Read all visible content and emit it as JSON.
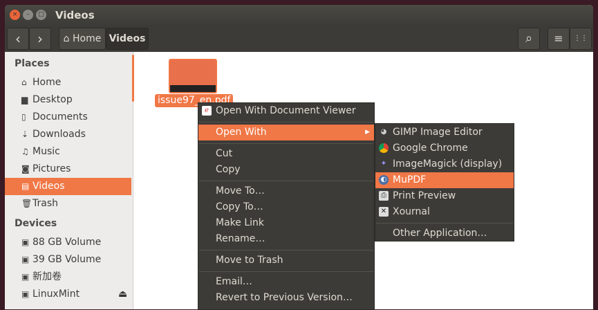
{
  "window": {
    "title": "Videos"
  },
  "toolbar": {
    "back": "‹",
    "forward": "›",
    "crumbs": [
      "Home",
      "Videos"
    ],
    "search": "⌕",
    "list": "≡",
    "grid": "⋮⋮"
  },
  "sidebar": {
    "places_heading": "Places",
    "places": [
      "Home",
      "Desktop",
      "Documents",
      "Downloads",
      "Music",
      "Pictures",
      "Videos",
      "Trash"
    ],
    "devices_heading": "Devices",
    "devices": [
      "88 GB Volume",
      "39 GB Volume",
      "新加卷",
      "LinuxMint"
    ]
  },
  "file": {
    "name": "issue97_en.pdf"
  },
  "context_menu": {
    "items": [
      "Open With Document Viewer",
      "Open With",
      "Cut",
      "Copy",
      "Move To…",
      "Copy To…",
      "Make Link",
      "Rename…",
      "Move to Trash",
      "Email…",
      "Revert to Previous Version…"
    ]
  },
  "submenu": {
    "items": [
      "GIMP Image Editor",
      "Google Chrome",
      "ImageMagick (display)",
      "MuPDF",
      "Print Preview",
      "Xournal",
      "Other Application…"
    ]
  },
  "colors": {
    "accent": "#f07746",
    "menu_bg": "#3c3b37"
  }
}
